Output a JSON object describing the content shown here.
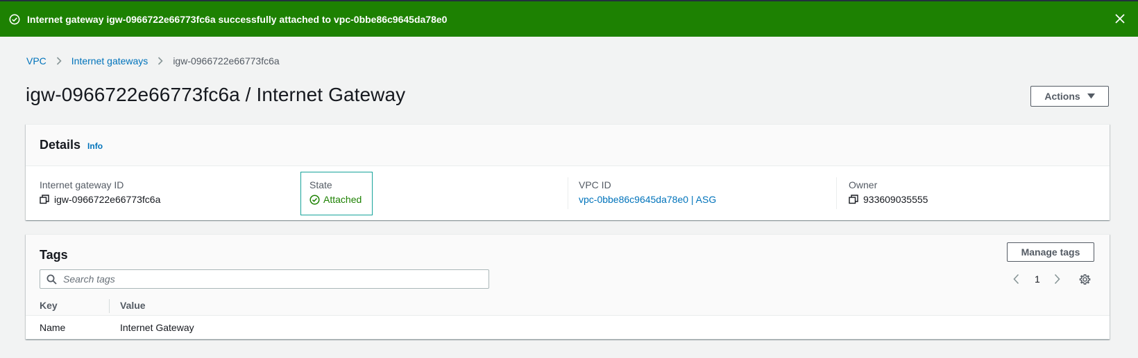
{
  "flash": {
    "message": "Internet gateway igw-0966722e66773fc6a successfully attached to vpc-0bbe86c9645da78e0",
    "color": "#1d8102"
  },
  "breadcrumb": {
    "items": [
      "VPC",
      "Internet gateways"
    ],
    "current": "igw-0966722e66773fc6a"
  },
  "page": {
    "title": "igw-0966722e66773fc6a / Internet Gateway",
    "actions_label": "Actions"
  },
  "details": {
    "title": "Details",
    "info_label": "Info",
    "fields": {
      "igw_id": {
        "label": "Internet gateway ID",
        "value": "igw-0966722e66773fc6a"
      },
      "state": {
        "label": "State",
        "value": "Attached"
      },
      "vpc_id": {
        "label": "VPC ID",
        "value": "vpc-0bbe86c9645da78e0 | ASG"
      },
      "owner": {
        "label": "Owner",
        "value": "933609035555"
      }
    }
  },
  "tags": {
    "title": "Tags",
    "manage_label": "Manage tags",
    "search_placeholder": "Search tags",
    "page_number": "1",
    "columns": [
      "Key",
      "Value"
    ],
    "rows": [
      {
        "key": "Name",
        "value": "Internet Gateway"
      }
    ]
  },
  "icons": {
    "success": "check-circle-icon",
    "close": "close-icon",
    "copy": "copy-icon",
    "search": "search-icon",
    "settings": "gear-icon"
  },
  "colors": {
    "link": "#0073bb",
    "success": "#1d8102",
    "state_border": "#16a39a"
  }
}
